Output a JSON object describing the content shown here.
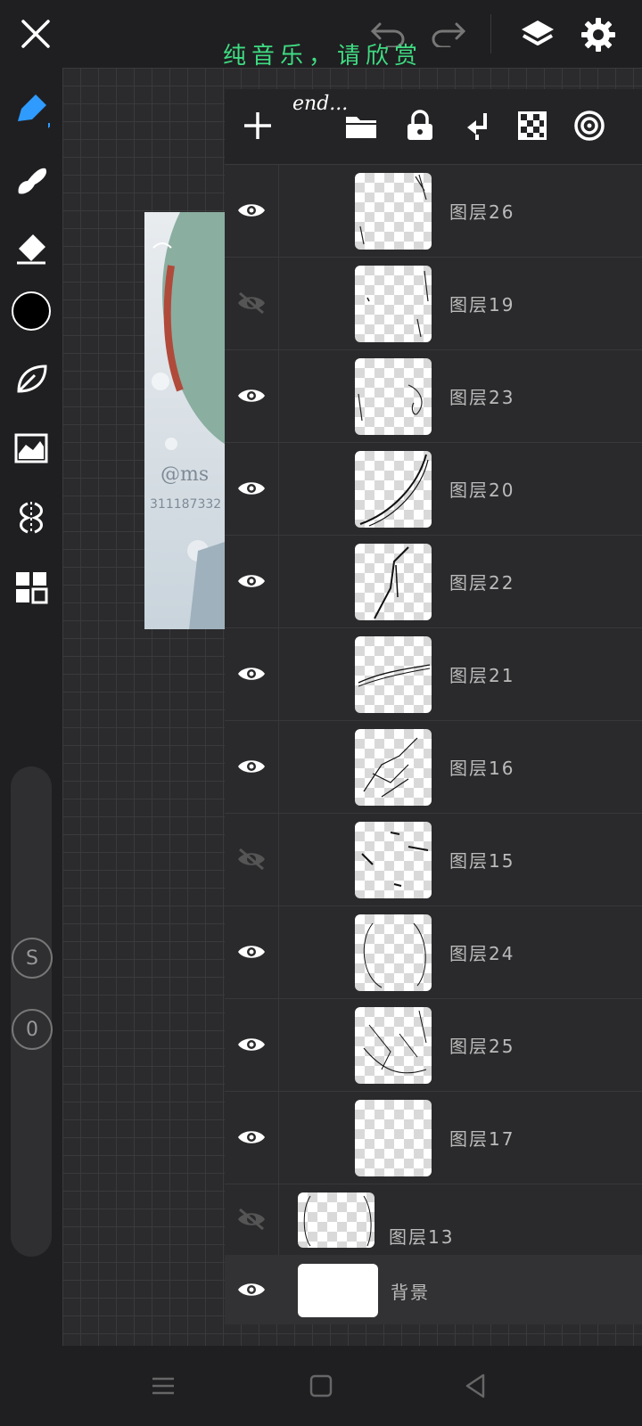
{
  "header": {
    "title_text": "纯音乐，请欣赏",
    "icons": [
      "close-icon",
      "undo-icon",
      "redo-icon",
      "layers-icon",
      "settings-icon"
    ]
  },
  "overlay_text": "end...",
  "toolbar": {
    "tools": [
      "pen-icon",
      "smudge-icon",
      "eraser-icon",
      "color-swatch",
      "leaf-brush-icon",
      "filter-icon",
      "symmetry-icon",
      "grid-icon"
    ],
    "color": "#000000",
    "slider_badges": [
      "S",
      "0"
    ]
  },
  "artwork": {
    "watermark_line1": "@ms",
    "watermark_line2": "311187332"
  },
  "layers_toolbar": {
    "icons": [
      "add-icon",
      "folder-icon",
      "lock-icon",
      "merge-down-icon",
      "transparency-icon",
      "blend-icon"
    ]
  },
  "layers": [
    {
      "name": "图层26",
      "visible": true
    },
    {
      "name": "图层19",
      "visible": false
    },
    {
      "name": "图层23",
      "visible": true
    },
    {
      "name": "图层20",
      "visible": true
    },
    {
      "name": "图层22",
      "visible": true
    },
    {
      "name": "图层21",
      "visible": true
    },
    {
      "name": "图层16",
      "visible": true
    },
    {
      "name": "图层15",
      "visible": false
    },
    {
      "name": "图层24",
      "visible": true
    },
    {
      "name": "图层25",
      "visible": true
    },
    {
      "name": "图层17",
      "visible": true
    },
    {
      "name": "图层13",
      "visible": false
    },
    {
      "name": "背景",
      "visible": true
    }
  ],
  "colors": {
    "accent": "#2f9bff",
    "title_green": "#3fdc82"
  }
}
